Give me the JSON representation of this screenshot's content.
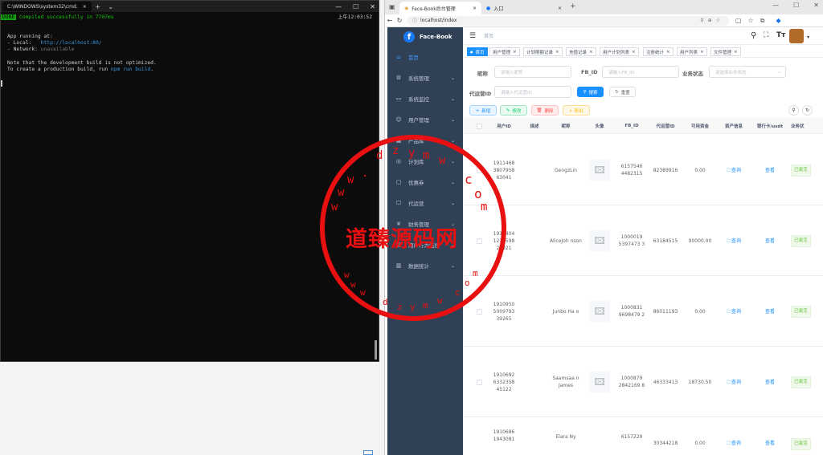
{
  "terminal": {
    "tab_title": "C:\\WINDOWS\\system32\\cmd.",
    "tab_close": "×",
    "new_tab": "+",
    "dropdown": "⌄",
    "done": "DONE",
    "compiled": "Compiled successfully in 7707ms",
    "time": "上午12:03:52",
    "lines": {
      "running": "App running at:",
      "local_label": "- Local:   ",
      "local_url": "http://localhost:80/",
      "network_label": "- Network: ",
      "network_value": "unavailable",
      "note": "Note that the development build is not optimized.",
      "to_create_a": "To create a production build, run ",
      "npm": "npm run build",
      "period": "."
    }
  },
  "browser": {
    "tabs": [
      {
        "title": "Face-Book后台管理"
      },
      {
        "title": "入口"
      }
    ],
    "url": "localhost/index"
  },
  "app": {
    "logo": "Face-Book",
    "logo_letter": "f",
    "menu": [
      {
        "label": "首页",
        "icon": "home-icon",
        "glyph": "⌂",
        "has_arrow": false
      },
      {
        "label": "系统管理",
        "icon": "gear-icon",
        "glyph": "⚙",
        "has_arrow": true
      },
      {
        "label": "系统监控",
        "icon": "monitor-icon",
        "glyph": "▭",
        "has_arrow": true
      },
      {
        "label": "用户管理",
        "icon": "users-icon",
        "glyph": "☺",
        "has_arrow": true
      },
      {
        "label": "产品库",
        "icon": "product-icon",
        "glyph": "▦",
        "has_arrow": true
      },
      {
        "label": "计划库",
        "icon": "plan-icon",
        "glyph": "◎",
        "has_arrow": true
      },
      {
        "label": "优惠券",
        "icon": "coupon-icon",
        "glyph": "▢",
        "has_arrow": true
      },
      {
        "label": "代运营",
        "icon": "operate-icon",
        "glyph": "☐",
        "has_arrow": true
      },
      {
        "label": "财务管理",
        "icon": "finance-icon",
        "glyph": "¥",
        "has_arrow": true
      },
      {
        "label": "用户行为监控",
        "icon": "behavior-icon",
        "glyph": "▤",
        "has_arrow": true
      },
      {
        "label": "数据统计",
        "icon": "stats-icon",
        "glyph": "▥",
        "has_arrow": true
      }
    ],
    "breadcrumb": "首页",
    "tags": [
      {
        "label": "首页"
      },
      {
        "label": "用户管理"
      },
      {
        "label": "计划限额记录"
      },
      {
        "label": "充值记录"
      },
      {
        "label": "用户计划列表"
      },
      {
        "label": "注册统计"
      },
      {
        "label": "用户列表"
      },
      {
        "label": "文件管理"
      }
    ],
    "filters": {
      "nickname_label": "昵称",
      "nickname_ph": "请输入昵称",
      "fbid_label": "FB_ID",
      "fbid_ph": "请输入FB_ID",
      "status_label": "业务状态",
      "status_ph": "请选择业务状态",
      "opid_label": "代运营ID",
      "opid_ph": "请输入代运营ID",
      "search": "搜索",
      "reset": "重置"
    },
    "actions": {
      "add": "新增",
      "edit": "修改",
      "delete": "删除",
      "export": "导出"
    },
    "columns": [
      "用户ID",
      "描述",
      "昵称",
      "头像",
      "FB_ID",
      "代运营ID",
      "可用资金",
      "资产信息",
      "银行卡/usdt",
      "业务状"
    ],
    "rows": [
      {
        "uid": "1911468 3807958 63041",
        "nick": "GengzLin",
        "fbid": "6157546 4482315",
        "opid": "82389916",
        "funds": "0.00",
        "asset": "查询",
        "bank": "查看",
        "status": "已激活"
      },
      {
        "uid": "1911404 1235598 20921",
        "nick": "AliceJoh nson",
        "fbid": "1000019 5397473 3",
        "opid": "63184515",
        "funds": "90000.00",
        "asset": "查询",
        "bank": "查看",
        "status": "已激活"
      },
      {
        "uid": "1910950 5009793 39265",
        "nick": "Junbo Ha o",
        "fbid": "1000831 9698479 2",
        "opid": "86011193",
        "funds": "0.00",
        "asset": "查询",
        "bank": "查看",
        "status": "已激活"
      },
      {
        "uid": "1910692 6332358 45122",
        "nick": "Saamsaa n James",
        "fbid": "1000879 2842169 8",
        "opid": "46333413",
        "funds": "18730.50",
        "asset": "查询",
        "bank": "查看",
        "status": "已激活"
      },
      {
        "uid": "1910686 1943081",
        "nick": "Elara Ny",
        "fbid": "6157229",
        "opid": "30344218",
        "funds": "0.00",
        "asset": "查询",
        "bank": "查看",
        "status": "已激活"
      }
    ]
  },
  "watermark": {
    "text": "道臻源码网",
    "chars": [
      "d",
      "z",
      "y",
      "m",
      "w",
      "c",
      "o",
      "m",
      "w",
      "w",
      "w",
      "d",
      "z",
      "y",
      "m",
      "w",
      "w",
      "w",
      "c",
      "o",
      "m",
      "w",
      "."
    ]
  }
}
